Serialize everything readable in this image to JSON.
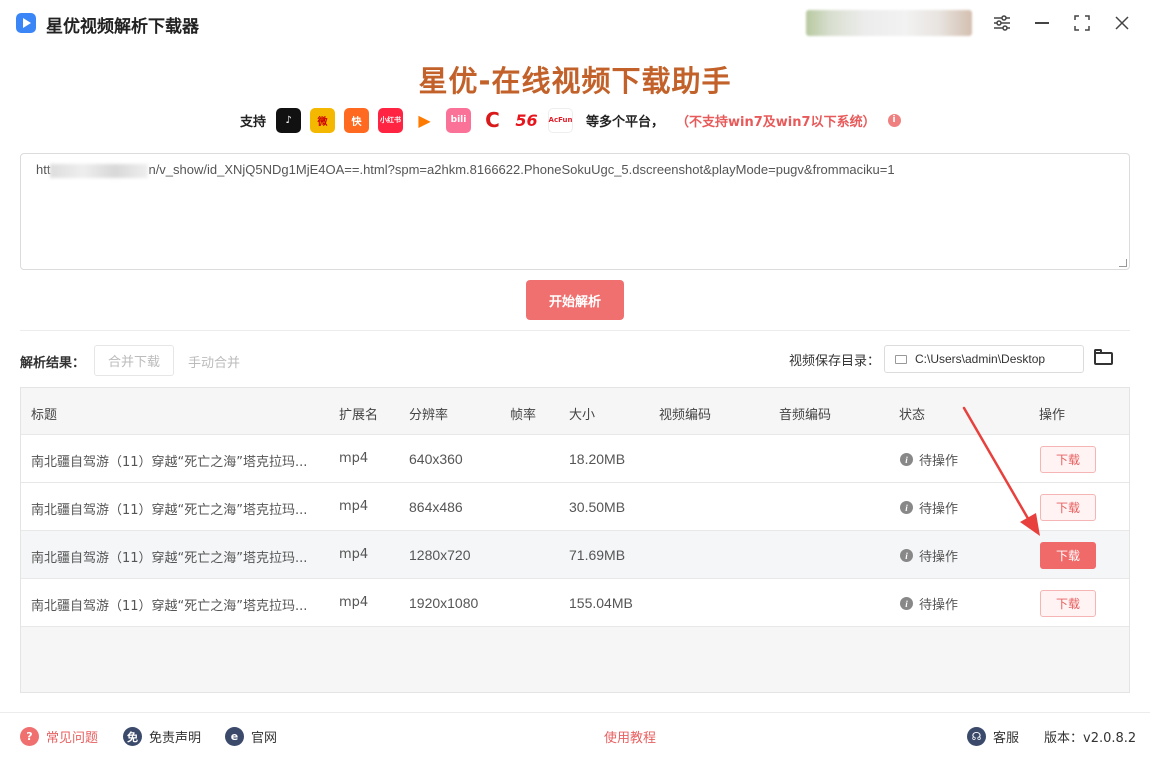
{
  "window": {
    "title": "星优视频解析下载器"
  },
  "hero": {
    "title": "星优-在线视频下载助手",
    "support_label": "支持",
    "more_platforms": "等多个平台，",
    "warning": "（不支持win7及win7以下系统）",
    "platforms": [
      {
        "name": "tiktok-icon",
        "glyph": "♪",
        "color": "#111111"
      },
      {
        "name": "weibo-icon",
        "glyph": "微",
        "color": "#f5b800"
      },
      {
        "name": "kuaishou-icon",
        "glyph": "快",
        "color": "#ff6a20"
      },
      {
        "name": "xiaohongshu-icon",
        "glyph": "小红书",
        "color": "#ff2442"
      },
      {
        "name": "tencent-video-icon",
        "glyph": "▶",
        "color": "#ffffff"
      },
      {
        "name": "bilibili-icon",
        "glyph": "bili",
        "color": "#fb7299"
      },
      {
        "name": "cctv-icon",
        "glyph": "C",
        "color": "#ffffff"
      },
      {
        "name": "56-icon",
        "glyph": "56",
        "color": "#ffffff"
      },
      {
        "name": "acfun-icon",
        "glyph": "AcFun",
        "color": "#ffffff"
      }
    ]
  },
  "url_input": {
    "prefix": "htt",
    "suffix": "n/v_show/id_XNjQ5NDg1MjE4OA==.html?spm=a2hkm.8166622.PhoneSokuUgc_5.dscreenshot&playMode=pugv&frommaciku=1"
  },
  "parse_button": "开始解析",
  "toolbar": {
    "result_label": "解析结果：",
    "merge_download": "合并下载",
    "manual_merge": "手动合并",
    "save_dir_label": "视频保存目录：",
    "save_dir_value": "C:\\Users\\admin\\Desktop"
  },
  "table": {
    "headers": [
      "标题",
      "扩展名",
      "分辨率",
      "帧率",
      "大小",
      "视频编码",
      "音频编码",
      "状态",
      "操作"
    ],
    "rows": [
      {
        "title": "南北疆自驾游（11）穿越“死亡之海”塔克拉玛...",
        "ext": "mp4",
        "resolution": "640x360",
        "fps": "",
        "size": "18.20MB",
        "vcodec": "",
        "acodec": "",
        "status": "待操作",
        "action": "下载"
      },
      {
        "title": "南北疆自驾游（11）穿越“死亡之海”塔克拉玛...",
        "ext": "mp4",
        "resolution": "864x486",
        "fps": "",
        "size": "30.50MB",
        "vcodec": "",
        "acodec": "",
        "status": "待操作",
        "action": "下载"
      },
      {
        "title": "南北疆自驾游（11）穿越“死亡之海”塔克拉玛...",
        "ext": "mp4",
        "resolution": "1280x720",
        "fps": "",
        "size": "71.69MB",
        "vcodec": "",
        "acodec": "",
        "status": "待操作",
        "action": "下载"
      },
      {
        "title": "南北疆自驾游（11）穿越“死亡之海”塔克拉玛...",
        "ext": "mp4",
        "resolution": "1920x1080",
        "fps": "",
        "size": "155.04MB",
        "vcodec": "",
        "acodec": "",
        "status": "待操作",
        "action": "下载"
      }
    ]
  },
  "footer": {
    "faq": "常见问题",
    "disclaimer": "免责声明",
    "website": "官网",
    "tutorial": "使用教程",
    "service": "客服",
    "version": "版本：v2.0.8.2"
  },
  "colors": {
    "accent": "#f07070",
    "hero_title": "#c2622a",
    "warning": "#e85a5a",
    "arrow": "#e8403c"
  }
}
